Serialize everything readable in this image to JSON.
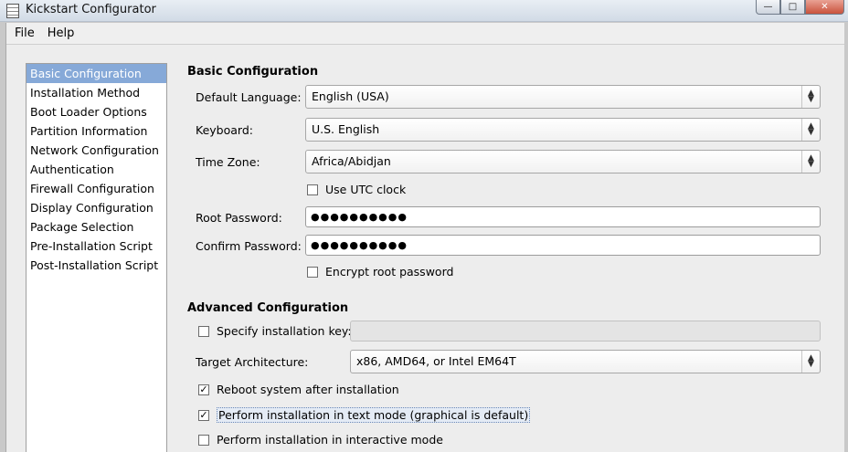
{
  "window": {
    "title": "Kickstart Configurator",
    "minimize_glyph": "—",
    "maximize_glyph": "□",
    "close_glyph": "✕"
  },
  "menu": [
    "File",
    "Help"
  ],
  "nav": {
    "selected": 0,
    "items": [
      "Basic Configuration",
      "Installation Method",
      "Boot Loader Options",
      "Partition Information",
      "Network Configuration",
      "Authentication",
      "Firewall Configuration",
      "Display Configuration",
      "Package Selection",
      "Pre-Installation Script",
      "Post-Installation Script"
    ]
  },
  "basic": {
    "title": "Basic Configuration",
    "language": {
      "label": "Default Language:",
      "value": "English (USA)"
    },
    "keyboard": {
      "label": "Keyboard:",
      "value": "U.S. English"
    },
    "timezone": {
      "label": "Time Zone:",
      "value": "Africa/Abidjan"
    },
    "utc": {
      "label": "Use UTC clock",
      "checked": false
    },
    "root_password": {
      "label": "Root Password:",
      "value": "●●●●●●●●●●"
    },
    "confirm_password": {
      "label": "Confirm Password:",
      "value": "●●●●●●●●●●"
    },
    "encrypt": {
      "label": "Encrypt root password",
      "checked": false
    }
  },
  "advanced": {
    "title": "Advanced Configuration",
    "install_key": {
      "label": "Specify installation key:",
      "checked": false,
      "value": ""
    },
    "arch": {
      "label": "Target Architecture:",
      "value": "x86, AMD64, or Intel EM64T"
    },
    "reboot": {
      "label": "Reboot system after installation",
      "checked": true
    },
    "text_mode": {
      "label": "Perform installation in text mode (graphical is default)",
      "checked": true
    },
    "interactive": {
      "label": "Perform installation in interactive mode",
      "checked": false
    }
  },
  "glyphs": {
    "check": "✓",
    "combo_up": "▲",
    "combo_down": "▼"
  }
}
